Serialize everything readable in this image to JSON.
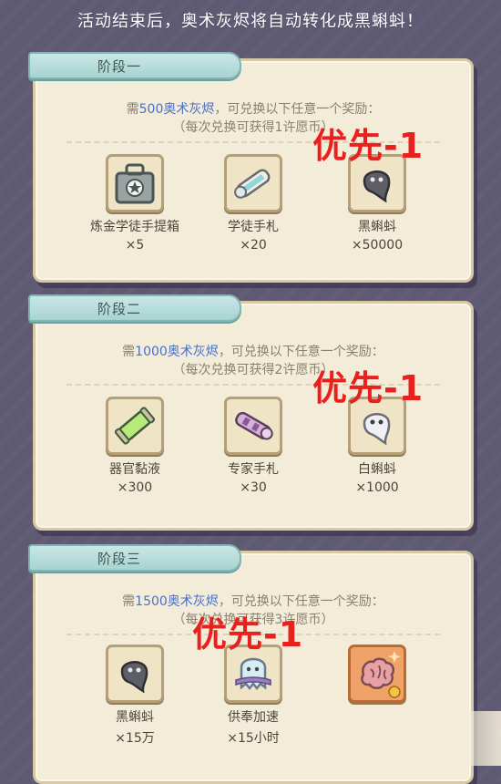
{
  "header": {
    "text": "活动结束后，奥术灰烬将自动转化成黑蝌蚪！"
  },
  "stamp_text": "优先-1",
  "colors": {
    "stamp": "#e8211e",
    "highlight": "#4a6fc7",
    "tag": "#a7d3d0"
  },
  "stages": [
    {
      "title": "阶段一",
      "desc_prefix": "需",
      "desc_highlight": "500奥术灰烬",
      "desc_suffix": "，可兑换以下任意一个奖励：",
      "desc2": "（每次兑换可获得1许愿币）",
      "items": [
        {
          "icon": "toolbox-icon",
          "name": "炼金学徒手提箱",
          "qty": "×5"
        },
        {
          "icon": "scroll-icon",
          "name": "学徒手札",
          "qty": "×20"
        },
        {
          "icon": "black-tadpole-icon",
          "name": "黑蝌蚪",
          "qty": "×50000"
        }
      ]
    },
    {
      "title": "阶段二",
      "desc_prefix": "需",
      "desc_highlight": "1000奥术灰烬",
      "desc_suffix": "，可兑换以下任意一个奖励：",
      "desc2": "（每次兑换可获得2许愿币）",
      "items": [
        {
          "icon": "vial-icon",
          "name": "器官黏液",
          "qty": "×300"
        },
        {
          "icon": "expert-scroll-icon",
          "name": "专家手札",
          "qty": "×30"
        },
        {
          "icon": "white-tadpole-icon",
          "name": "白蝌蚪",
          "qty": "×1000"
        }
      ]
    },
    {
      "title": "阶段三",
      "desc_prefix": "需",
      "desc_highlight": "1500奥术灰烬",
      "desc_suffix": "，可兑换以下任意一个奖励：",
      "desc2": "（每次兑换可获得3许愿币）",
      "items": [
        {
          "icon": "black-tadpole-icon",
          "name": "黑蝌蚪",
          "qty": "×15万"
        },
        {
          "icon": "ghost-speedup-icon",
          "name": "供奉加速",
          "qty": "×15小时"
        },
        {
          "icon": "brain-icon",
          "name": "",
          "qty": ""
        }
      ]
    }
  ]
}
